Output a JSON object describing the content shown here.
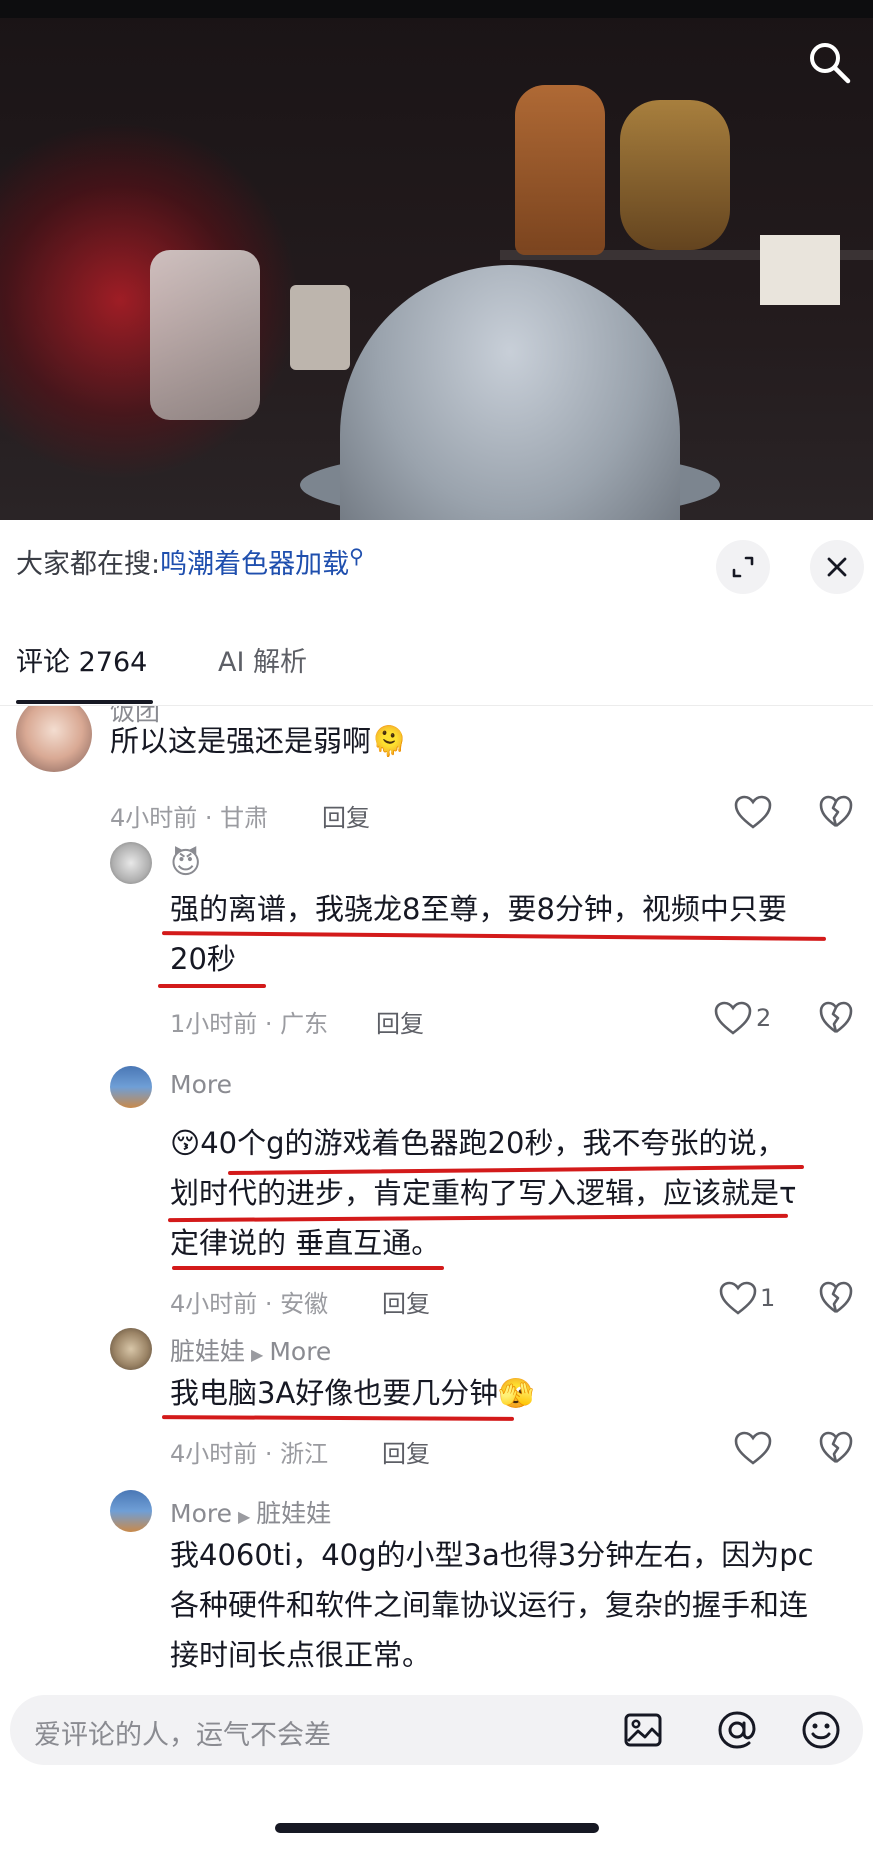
{
  "hot_search": {
    "prefix": "大家都在搜:",
    "link": "鸣潮着色器加载",
    "mag": "⚲"
  },
  "tabs": {
    "comments": "评论 2764",
    "ai": "AI 解析"
  },
  "comments": [
    {
      "user": "饭团",
      "text": "所以这是强还是弱啊",
      "emoji": "🫠",
      "meta": "4小时前 · 甘肃",
      "reply": "回复",
      "likes": ""
    },
    {
      "user": "😈",
      "text_line1": "强的离谱，我骁龙8至尊，要8分钟，视频中只要",
      "text_line2": "20秒",
      "meta": "1小时前 · 广东",
      "reply": "回复",
      "likes": "2"
    },
    {
      "user": "More",
      "emoji": "😚",
      "text_line1": "40个g的游戏着色器跑20秒，我不夸张的说，",
      "text_line2": "划时代的进步，肯定重构了写入逻辑，应该就是τ",
      "text_line3": "定律说的 垂直互通。",
      "meta": "4小时前 · 安徽",
      "reply": "回复",
      "likes": "1"
    },
    {
      "user": "脏娃娃",
      "reply_to": "More",
      "text": "我电脑3A好像也要几分钟",
      "emoji": "🫣",
      "meta": "4小时前 · 浙江",
      "reply": "回复",
      "likes": ""
    },
    {
      "user": "More",
      "reply_to": "脏娃娃",
      "text_line1": "我4060ti，40g的小型3a也得3分钟左右，因为pc",
      "text_line2": "各种硬件和软件之间靠协议运行，复杂的握手和连",
      "text_line3": "接时间长点很正常。"
    }
  ],
  "input": {
    "placeholder": "爱评论的人，运气不会差"
  },
  "colors": {
    "accent_link": "#1f4fae",
    "annotation_red": "#d31a1a"
  }
}
